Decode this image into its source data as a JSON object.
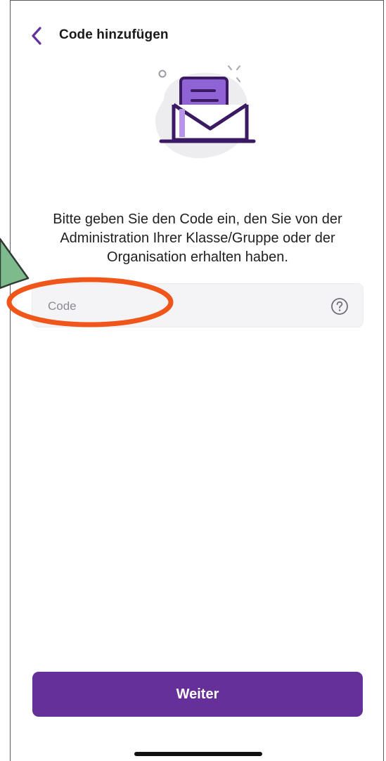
{
  "header": {
    "title": "Code hinzufügen",
    "back_icon": "chevron-left-icon"
  },
  "illustration": {
    "icon": "envelope-document-icon"
  },
  "instruction": {
    "text": "Bitte geben Sie den Code ein, den Sie von der Administration Ihrer Klasse/Gruppe oder der Organisation erhalten haben."
  },
  "code_field": {
    "placeholder": "Code",
    "value": "",
    "help_icon": "question-circle-icon"
  },
  "footer": {
    "continue_label": "Weiter"
  },
  "colors": {
    "accent": "#65309a",
    "annotation_ellipse": "#f0561a",
    "annotation_arrow": "#7dbb8c"
  }
}
